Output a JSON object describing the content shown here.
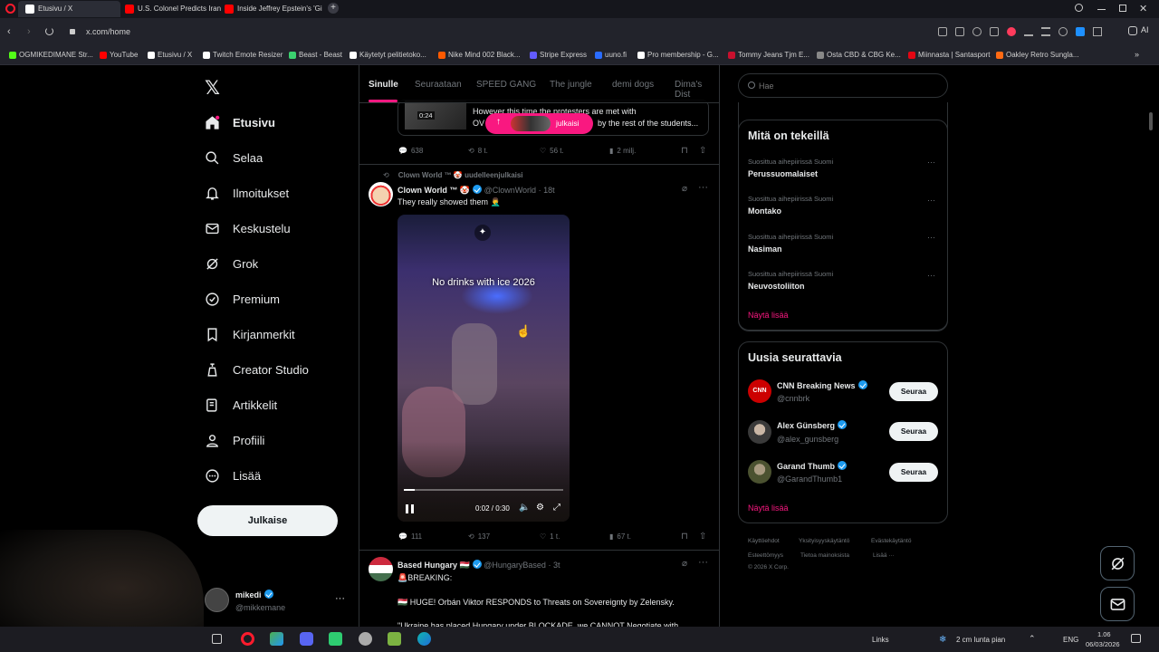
{
  "browser": {
    "tabs": [
      {
        "label": "Etusivu / X",
        "color": "#ffffff"
      },
      {
        "label": "U.S. Colonel Predicts Iran",
        "color": "#ff0000"
      },
      {
        "label": "Inside Jeffrey Epstein's 'Gi",
        "color": "#ff0000"
      }
    ],
    "new_tab": "+",
    "url": "x.com/home",
    "ai_label": "AI",
    "bookmarks": [
      {
        "label": "OGMIKEDIMANE Str...",
        "color": "#53fc18"
      },
      {
        "label": "YouTube",
        "color": "#ff0000"
      },
      {
        "label": "Etusivu / X",
        "color": "#ffffff"
      },
      {
        "label": "Twitch Emote Resizer",
        "color": "#ffffff"
      },
      {
        "label": "Beast - Beast",
        "color": "#3bd16f"
      },
      {
        "label": "Käytetyt pelitietoko...",
        "color": "#ffffff"
      },
      {
        "label": "Nike Mind 002 Black...",
        "color": "#ff5a00"
      },
      {
        "label": "Stripe Express",
        "color": "#635bff"
      },
      {
        "label": "uuno.fi",
        "color": "#2a6cff"
      },
      {
        "label": "Pro membership - G...",
        "color": "#ffffff"
      },
      {
        "label": "Tommy Jeans Tjm E...",
        "color": "#c8102e"
      },
      {
        "label": "Osta CBD & CBG Ke...",
        "color": "#888888"
      },
      {
        "label": "Miinnasta | Santasport",
        "color": "#e30613"
      },
      {
        "label": "Oakley Retro Sungla...",
        "color": "#ff6a13"
      }
    ]
  },
  "nav": {
    "items": [
      {
        "label": "Etusivu",
        "icon": "home-icon"
      },
      {
        "label": "Selaa",
        "icon": "search-icon"
      },
      {
        "label": "Ilmoitukset",
        "icon": "bell-icon"
      },
      {
        "label": "Keskustelu",
        "icon": "mail-icon"
      },
      {
        "label": "Grok",
        "icon": "grok-icon"
      },
      {
        "label": "Premium",
        "icon": "premium-icon"
      },
      {
        "label": "Kirjanmerkit",
        "icon": "bookmark-icon"
      },
      {
        "label": "Creator Studio",
        "icon": "creator-icon"
      },
      {
        "label": "Artikkelit",
        "icon": "article-icon"
      },
      {
        "label": "Profiili",
        "icon": "profile-icon"
      },
      {
        "label": "Lisää",
        "icon": "more-icon"
      }
    ],
    "post_button": "Julkaise",
    "account": {
      "name": "mikedi",
      "handle": "@mikkemane",
      "more": "···"
    }
  },
  "feed": {
    "tabs": [
      "Sinulle",
      "Seuraataan",
      "SPEED GANG",
      "The jungle",
      "demi dogs",
      "Dima's Dist"
    ],
    "new_posts_pill": "julkaisi",
    "prev_post": {
      "video_time": "0:24",
      "text1": "However this time the protesters are met with",
      "text2": "OV",
      "text3": "by the rest of the students...",
      "replies": "638",
      "reposts": "8 t.",
      "likes": "56 t.",
      "views": "2 milj."
    },
    "post1": {
      "repost_label": "Clown World ™ 🤡 uudelleenjulkaisi",
      "author": "Clown World ™ 🤡",
      "handle": "@ClownWorld",
      "sep": "·",
      "time": "18t",
      "text": "They really showed them 🤦‍♂️",
      "video_caption": "No drinks with ice 2026",
      "video_time": "0:02 / 0:30",
      "video_progress": 0.07,
      "replies": "111",
      "reposts": "137",
      "likes": "1 t.",
      "views": "67 t."
    },
    "post2": {
      "author": "Based Hungary 🇭🇺",
      "handle": "@HungaryBased",
      "sep": "·",
      "time": "3t",
      "line1": "🚨BREAKING:",
      "line2": "🇭🇺 HUGE! Orbán Viktor RESPONDS to Threats on Sovereignty by Zelensky.",
      "line3": "\"Ukraine has placed Hungary under BLOCKADE, we CANNOT Negotiate with"
    }
  },
  "right": {
    "search_placeholder": "Hae",
    "trends_title": "Mitä on tekeillä",
    "trends": [
      {
        "category": "Suosittua aihepiirissä Suomi",
        "name": "Perussuomalaiset"
      },
      {
        "category": "Suosittua aihepiirissä Suomi",
        "name": "Montako"
      },
      {
        "category": "Suosittua aihepiirissä Suomi",
        "name": "Nasiman"
      },
      {
        "category": "Suosittua aihepiirissä Suomi",
        "name": "Neuvostoliiton"
      }
    ],
    "show_more": "Näytä lisää",
    "follow_title": "Uusia seurattavia",
    "follows": [
      {
        "name": "CNN Breaking News",
        "handle": "@cnnbrk",
        "button": "Seuraa",
        "avatar_text": "CNN"
      },
      {
        "name": "Alex Günsberg",
        "handle": "@alex_gunsberg",
        "button": "Seuraa",
        "avatar_text": ""
      },
      {
        "name": "Garand Thumb",
        "handle": "@GarandThumb1",
        "button": "Seuraa",
        "avatar_text": ""
      }
    ],
    "show_more2": "Näytä lisää",
    "footer": [
      "Käyttöehdot",
      "Yksityisyyskäytäntö",
      "Evästekäytäntö",
      "Esteettömyys",
      "Tietoa mainoksista",
      "Lisää ···",
      "© 2026 X Corp."
    ]
  },
  "taskbar": {
    "links": "Links",
    "weather": "2 cm lunta pian",
    "lang": "ENG",
    "time": "1.06",
    "date": "06/03/2026"
  }
}
